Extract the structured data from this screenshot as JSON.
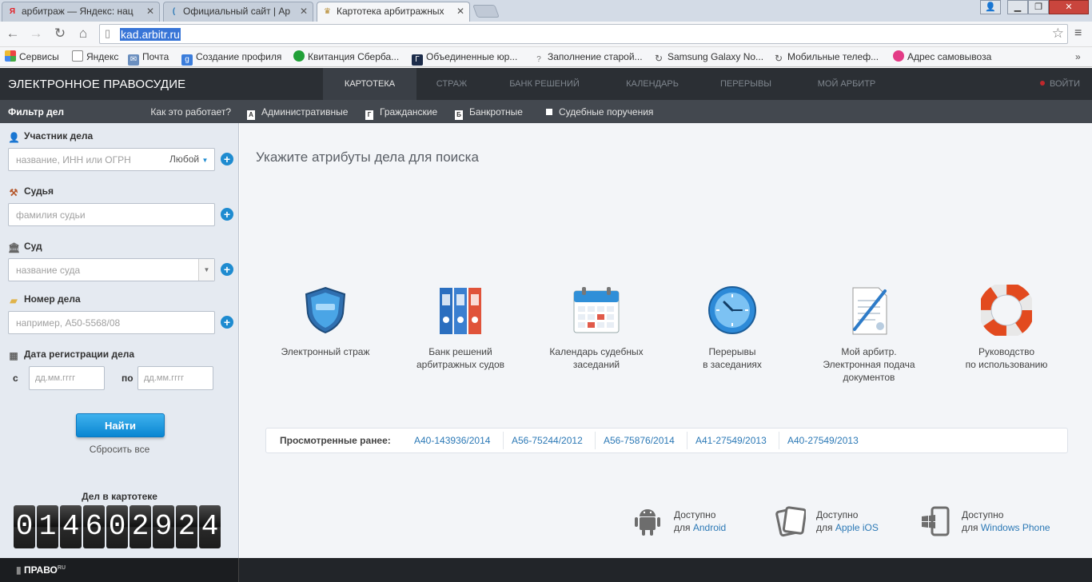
{
  "browser": {
    "tabs": [
      {
        "title": "арбитраж — Яндекс: нац",
        "icon": "yandex-icon"
      },
      {
        "title": "Официальный сайт | Ар",
        "icon": "arbitr-icon"
      },
      {
        "title": "Картотека арбитражных",
        "icon": "eagle-icon",
        "active": true
      }
    ],
    "url": "kad.arbitr.ru",
    "bookmarks": [
      {
        "label": "Сервисы",
        "icon": "apps-icon"
      },
      {
        "label": "Яндекс",
        "icon": "page-icon"
      },
      {
        "label": "Почта",
        "icon": "mail-icon"
      },
      {
        "label": "Создание профиля",
        "icon": "google-icon"
      },
      {
        "label": "Квитанция Сберба...",
        "icon": "sberbank-icon"
      },
      {
        "label": "Объединенные юр...",
        "icon": "law-icon"
      },
      {
        "label": "Заполнение старой...",
        "icon": "question-icon"
      },
      {
        "label": "Samsung Galaxy No...",
        "icon": "refresh-icon"
      },
      {
        "label": "Мобильные телеф...",
        "icon": "refresh-icon"
      },
      {
        "label": "Адрес самовывоза",
        "icon": "apple-icon"
      }
    ]
  },
  "header": {
    "logo": "ЭЛЕКТРОННОЕ ПРАВОСУДИЕ",
    "nav": [
      "КАРТОТЕКА",
      "СТРАЖ",
      "БАНК РЕШЕНИЙ",
      "КАЛЕНДАРЬ",
      "ПЕРЕРЫВЫ",
      "МОЙ АРБИТР"
    ],
    "login": "ВОЙТИ"
  },
  "filter": {
    "title": "Фильтр дел",
    "how": "Как это работает?",
    "participant_label": "Участник дела",
    "participant_placeholder": "название, ИНН или ОГРН",
    "participant_role": "Любой",
    "judge_label": "Судья",
    "judge_placeholder": "фамилия судьи",
    "court_label": "Суд",
    "court_placeholder": "название суда",
    "case_label": "Номер дела",
    "case_placeholder": "например, А50-5568/08",
    "date_label": "Дата регистрации дела",
    "from_label": "с",
    "to_label": "по",
    "date_placeholder": "дд.мм.гггг",
    "find": "Найти",
    "reset": "Сбросить все",
    "count_title": "Дел в картотеке",
    "count_digits": [
      "0",
      "1",
      "4",
      "6",
      "0",
      "2",
      "9",
      "2",
      "4"
    ]
  },
  "categories": [
    "Административные",
    "Гражданские",
    "Банкротные",
    "Судебные поручения"
  ],
  "main": {
    "title": "Укажите атрибуты дела для поиска",
    "tiles": [
      {
        "line1": "Электронный страж",
        "line2": "",
        "line3": ""
      },
      {
        "line1": "Банк решений",
        "line2": "арбитражных судов",
        "line3": ""
      },
      {
        "line1": "Календарь судебных",
        "line2": "заседаний",
        "line3": ""
      },
      {
        "line1": "Перерывы",
        "line2": "в заседаниях",
        "line3": ""
      },
      {
        "line1": "Мой арбитр.",
        "line2": "Электронная подача",
        "line3": "документов"
      },
      {
        "line1": "Руководство",
        "line2": "по использованию",
        "line3": ""
      }
    ],
    "recent_label": "Просмотренные ранее:",
    "recent": [
      "А40-143936/2014",
      "А56-75244/2012",
      "А56-75876/2014",
      "А41-27549/2013",
      "А40-27549/2013"
    ],
    "apps": [
      {
        "line1": "Доступно",
        "prefix": "для ",
        "platform": "Android"
      },
      {
        "line1": "Доступно",
        "prefix": "для ",
        "platform": "Apple iOS"
      },
      {
        "line1": "Доступно",
        "prefix": "для ",
        "platform": "Windows Phone"
      }
    ]
  },
  "footer": {
    "brand": "ПРАВО",
    "brand_sup": "RU"
  },
  "colors": {
    "accent": "#1e8bd0",
    "header": "#2b2f34",
    "link": "#2c79b6"
  }
}
